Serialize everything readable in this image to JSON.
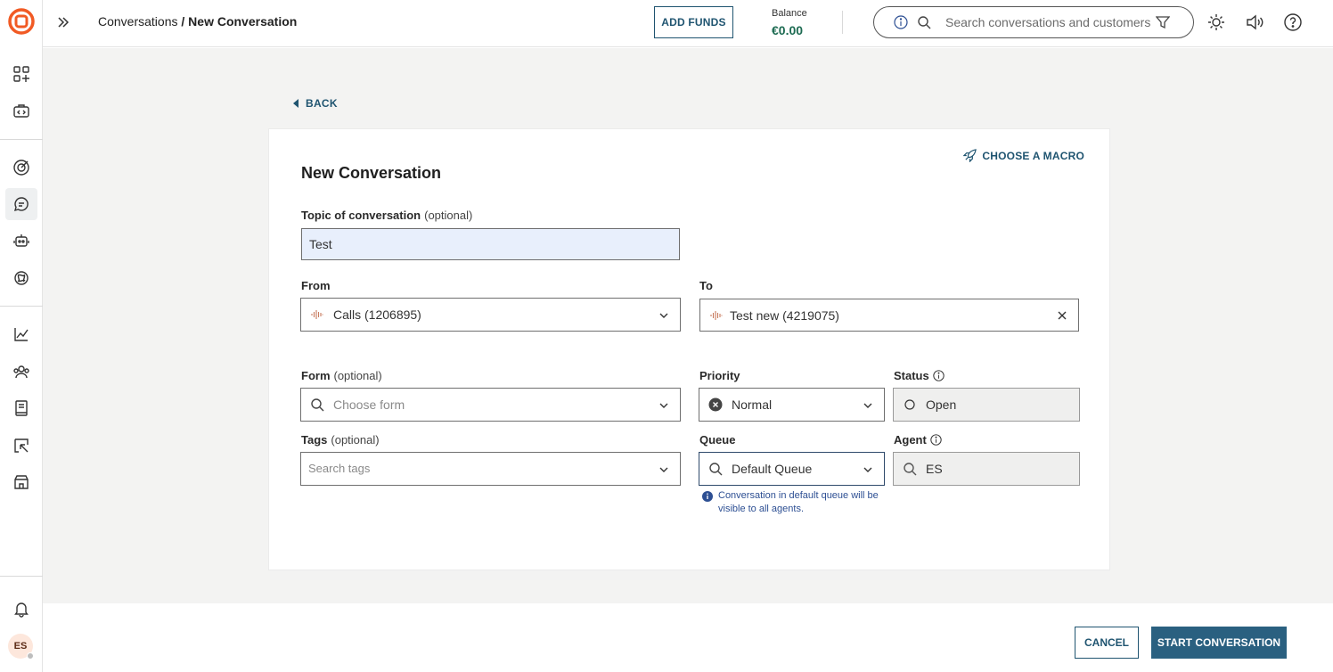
{
  "colors": {
    "brand": "#f15a24",
    "accent": "#1f5470",
    "primary_button": "#2a6080",
    "balance": "#1d6b52",
    "info_text": "#2d4f93"
  },
  "sidebar": {
    "items": [
      {
        "icon": "apps-icon"
      },
      {
        "icon": "code-icon"
      },
      {
        "icon": "target-icon"
      },
      {
        "icon": "chat-icon",
        "active": true
      },
      {
        "icon": "bot-icon"
      },
      {
        "icon": "ai-icon"
      },
      {
        "icon": "analytics-icon"
      },
      {
        "icon": "customers-icon"
      },
      {
        "icon": "knowledge-icon"
      },
      {
        "icon": "reports-icon"
      },
      {
        "icon": "store-icon"
      }
    ],
    "notifications_icon": "bell-icon",
    "avatar_initials": "ES"
  },
  "header": {
    "breadcrumb_parent": "Conversations",
    "breadcrumb_sep": " / ",
    "breadcrumb_current": "New Conversation",
    "add_funds_label": "ADD FUNDS",
    "balance_label": "Balance",
    "balance_value": "€0.00",
    "search_placeholder": "Search conversations and customers"
  },
  "page": {
    "back_label": "BACK",
    "macro_label": "CHOOSE A MACRO",
    "title": "New Conversation"
  },
  "form": {
    "topic": {
      "label": "Topic of conversation",
      "optional": "(optional)",
      "value": "Test"
    },
    "from": {
      "label": "From",
      "value": "Calls (1206895)"
    },
    "to": {
      "label": "To",
      "value": "Test new (4219075)"
    },
    "form_field": {
      "label": "Form",
      "optional": "(optional)",
      "placeholder": "Choose form"
    },
    "priority": {
      "label": "Priority",
      "value": "Normal"
    },
    "status": {
      "label": "Status",
      "value": "Open"
    },
    "tags": {
      "label": "Tags",
      "optional": "(optional)",
      "placeholder": "Search tags"
    },
    "queue": {
      "label": "Queue",
      "value": "Default Queue",
      "help": "Conversation in default queue will be visible to all agents."
    },
    "agent": {
      "label": "Agent",
      "value": "ES"
    }
  },
  "footer": {
    "cancel_label": "CANCEL",
    "start_label": "START CONVERSATION"
  }
}
